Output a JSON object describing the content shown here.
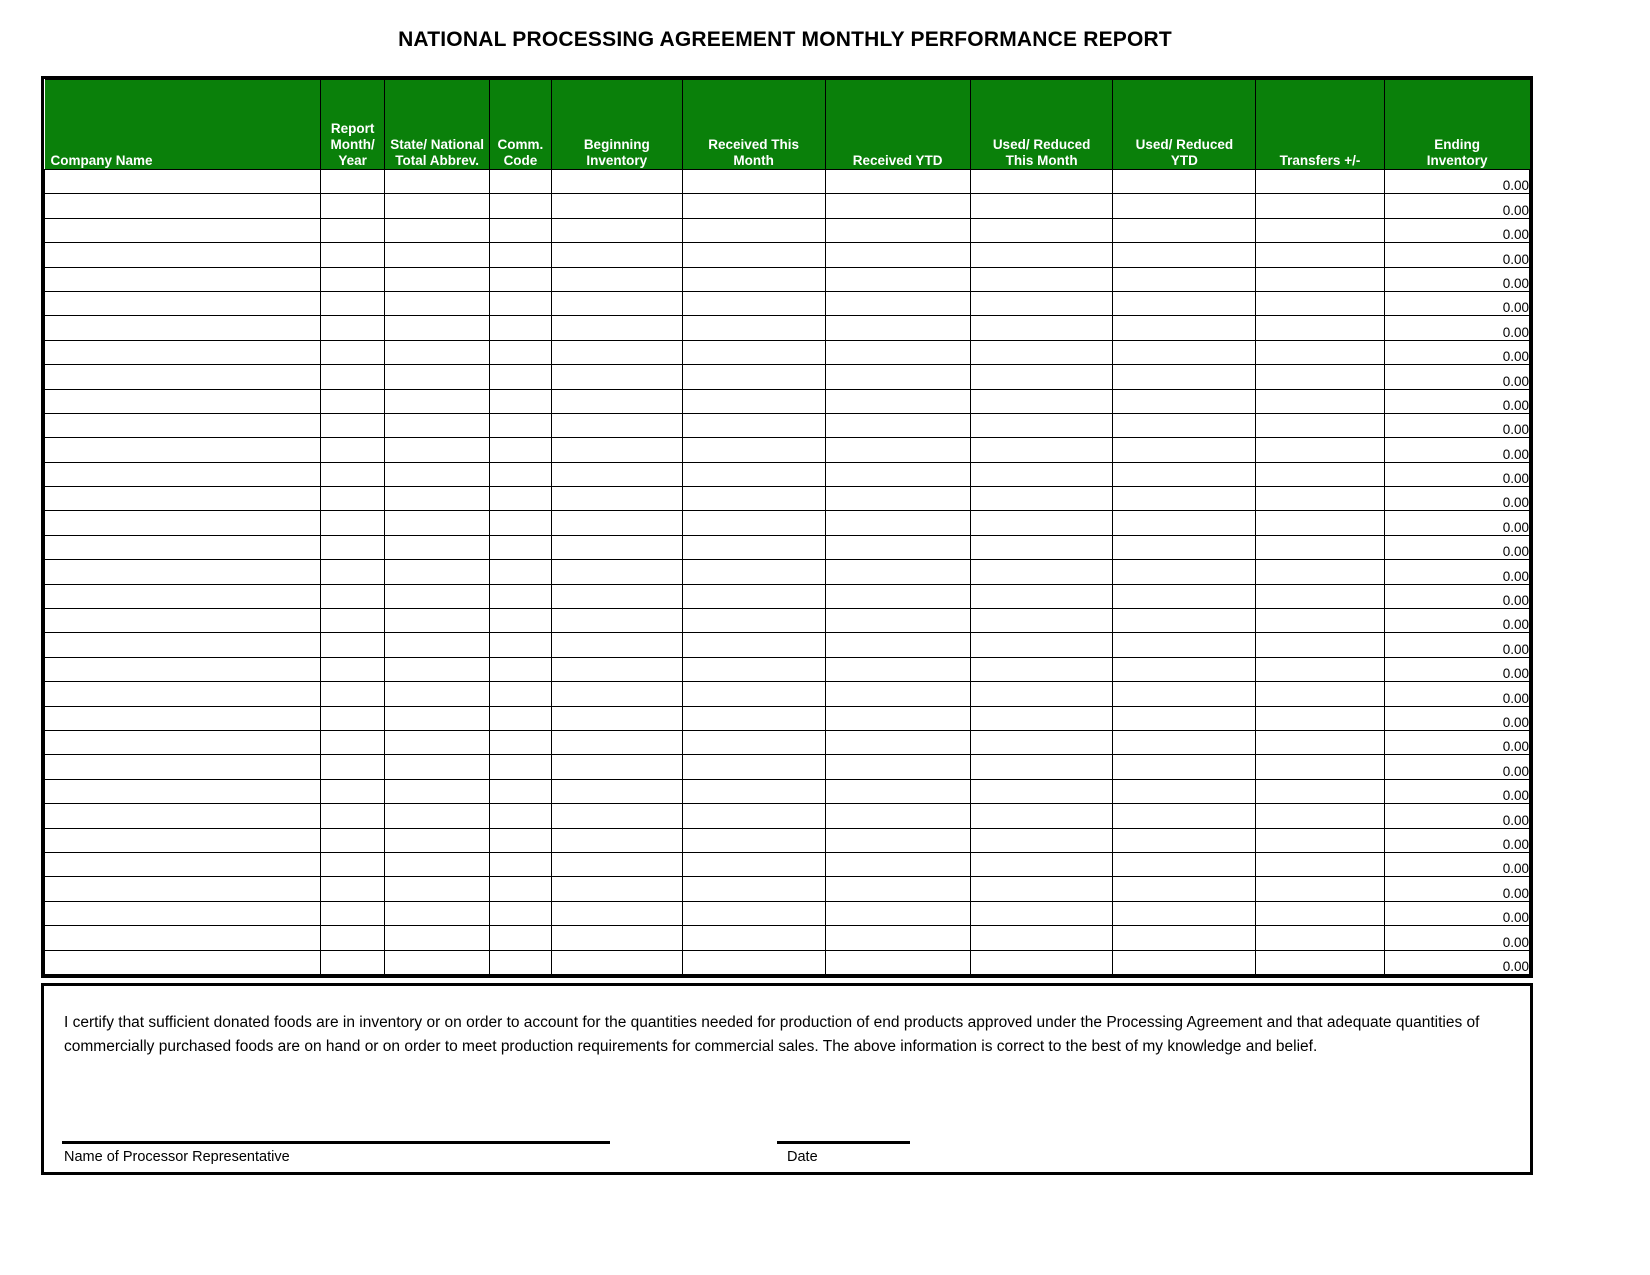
{
  "document": {
    "title": "NATIONAL PROCESSING AGREEMENT MONTHLY PERFORMANCE REPORT"
  },
  "theme": {
    "header_background": "#0a800a",
    "header_text": "#ffffff",
    "border": "#000000",
    "page_background": "#ffffff"
  },
  "table": {
    "columns": [
      {
        "key": "company_name",
        "label": "Company Name",
        "label_line2": "",
        "align": "left"
      },
      {
        "key": "report_month_year",
        "label": "Report",
        "label_line2": "Month/ Year",
        "align": "center"
      },
      {
        "key": "state_national",
        "label": "State/ National",
        "label_line2": "Total Abbrev.",
        "align": "center"
      },
      {
        "key": "comm_code",
        "label": "Comm.",
        "label_line2": "Code",
        "align": "center"
      },
      {
        "key": "beginning_inv",
        "label": "Beginning",
        "label_line2": "Inventory",
        "align": "center"
      },
      {
        "key": "received_month",
        "label": "Received This",
        "label_line2": "Month",
        "align": "center"
      },
      {
        "key": "received_ytd",
        "label": "",
        "label_line2": "Received  YTD",
        "align": "center"
      },
      {
        "key": "used_month",
        "label": "Used/ Reduced",
        "label_line2": "This Month",
        "align": "center"
      },
      {
        "key": "used_ytd",
        "label": "Used/ Reduced",
        "label_line2": "YTD",
        "align": "center"
      },
      {
        "key": "transfers",
        "label": "",
        "label_line2": "Transfers  +/-",
        "align": "center"
      },
      {
        "key": "ending_inv",
        "label": "Ending",
        "label_line2": "Inventory",
        "align": "center"
      }
    ],
    "row_count": 33,
    "ending_inventory_default": "0.00",
    "rows": [
      {
        "company_name": "",
        "report_month_year": "",
        "state_national": "",
        "comm_code": "",
        "beginning_inv": "",
        "received_month": "",
        "received_ytd": "",
        "used_month": "",
        "used_ytd": "",
        "transfers": "",
        "ending_inv": "0.00"
      }
    ]
  },
  "certification": {
    "text": "I certify that sufficient donated foods are in inventory or on order to account for the quantities needed for production of end products approved under the Processing Agreement and that adequate quantities of commercially purchased foods are on hand or on order to meet production requirements for commercial sales.  The above information is correct to the best of my knowledge and belief.",
    "signature_label": "Name of Processor Representative",
    "date_label": "Date",
    "signature_value": "",
    "date_value": ""
  }
}
